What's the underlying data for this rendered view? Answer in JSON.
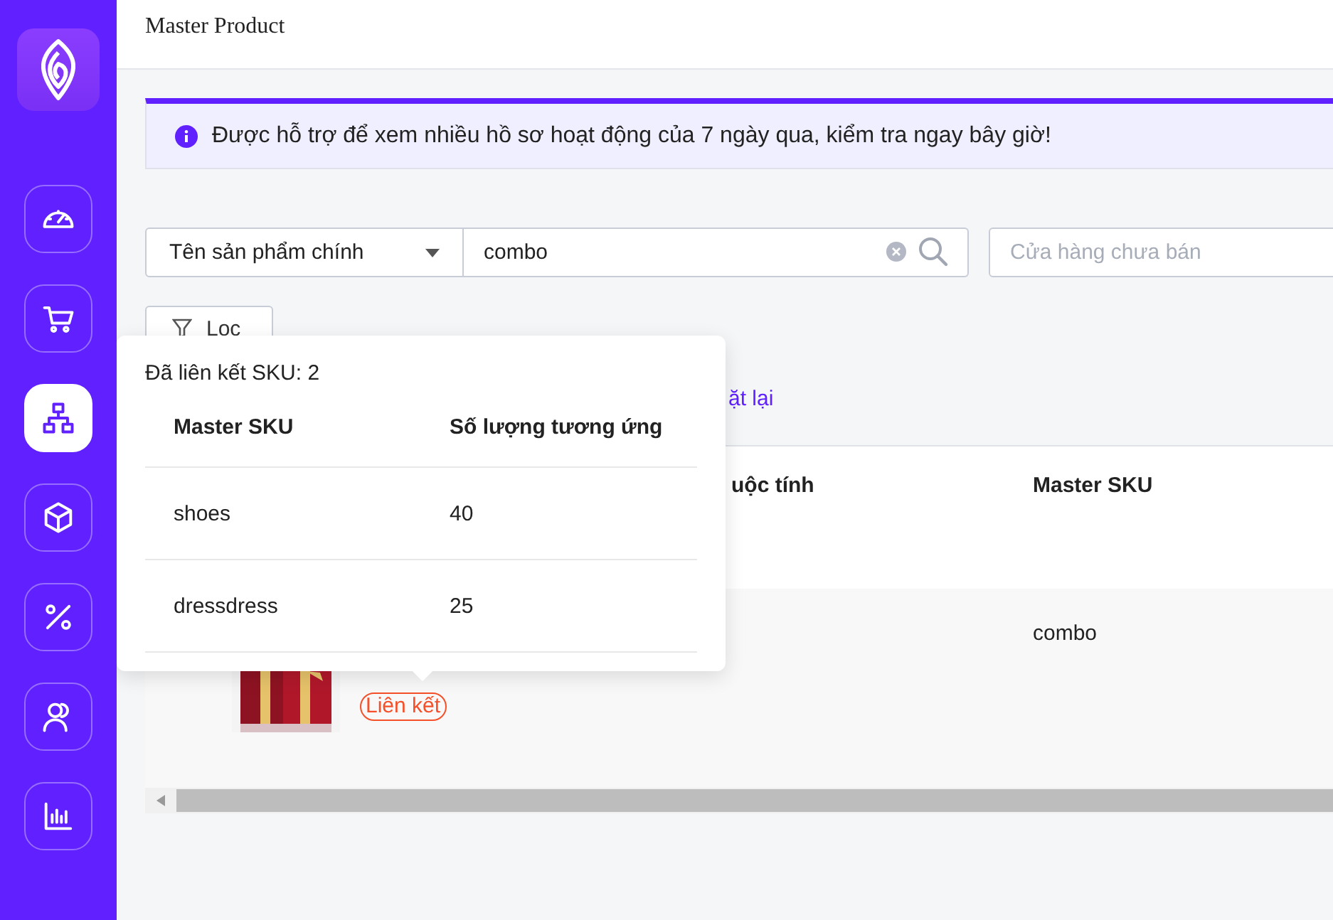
{
  "sidebar": {
    "items": [
      {
        "kind": "gauge",
        "selected": false
      },
      {
        "kind": "cart",
        "selected": false
      },
      {
        "kind": "hierarchy",
        "selected": true
      },
      {
        "kind": "cube",
        "selected": false
      },
      {
        "kind": "percent",
        "selected": false
      },
      {
        "kind": "users",
        "selected": false
      },
      {
        "kind": "chart",
        "selected": false
      }
    ]
  },
  "header": {
    "title": "Master Product"
  },
  "alert": {
    "text": "Được hỗ trợ để xem nhiều hồ sơ hoạt động của 7 ngày qua, kiểm tra ngay bây giờ!"
  },
  "filters": {
    "field_select": "Tên sản phẩm chính",
    "search_value": "combo",
    "store_placeholder": "Cửa hàng chưa bán"
  },
  "filter_button": "Lọc",
  "reset_link": "ặt lại",
  "table": {
    "columns": [
      "uộc tính",
      "Master SKU"
    ],
    "rows": [
      {
        "link_tag": "Liên kết",
        "master_sku": "combo"
      }
    ]
  },
  "popover": {
    "title": "Đã liên kết SKU: 2",
    "columns": [
      "Master SKU",
      "Số lượng tương ứng"
    ],
    "rows": [
      {
        "sku": "shoes",
        "quantity": "40"
      },
      {
        "sku": "dressdress",
        "quantity": "25"
      }
    ]
  }
}
